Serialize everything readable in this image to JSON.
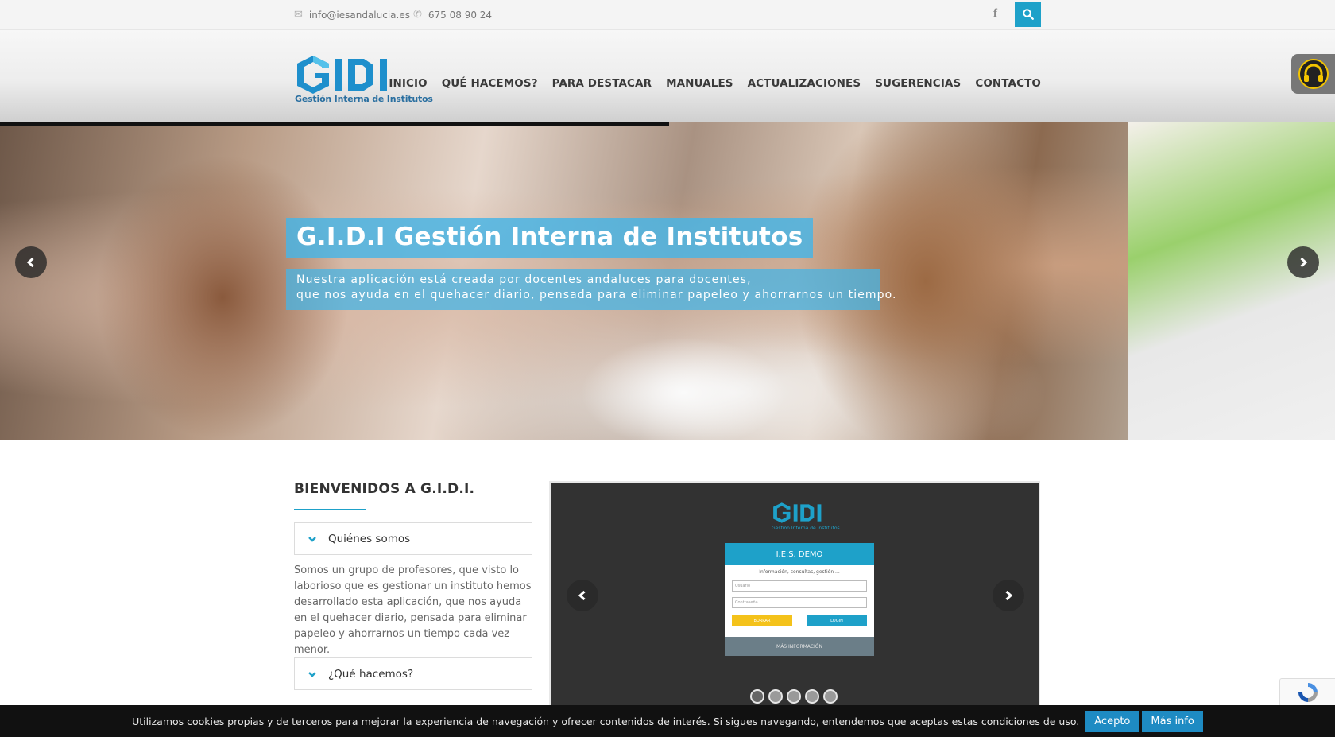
{
  "topbar": {
    "email": "info@iesandalucia.es",
    "phone": "675 08 90 24",
    "facebook_glyph": "f"
  },
  "logo": {
    "letters": "GIDI",
    "tagline": "Gestión Interna de Institutos"
  },
  "nav": [
    "INICIO",
    "QUÉ HACEMOS?",
    "PARA DESTACAR",
    "MANUALES",
    "ACTUALIZACIONES",
    "SUGERENCIAS",
    "CONTACTO"
  ],
  "hero": {
    "title": "G.I.D.I Gestión Interna de Institutos",
    "subtitle_line1": "Nuestra aplicación está creada por docentes andaluces para docentes,",
    "subtitle_line2": "que nos ayuda en el quehacer diario, pensada para eliminar papeleo y ahorrarnos un tiempo."
  },
  "welcome": {
    "heading": "BIENVENIDOS A G.I.D.I.",
    "accordion1": "Quiénes somos",
    "accordion1_text": "Somos un grupo de profesores, que visto lo laborioso que es gestionar un instituto hemos desarrollado esta aplicación, que nos ayuda en el quehacer diario, pensada para eliminar papeleo y ahorrarnos un tiempo cada vez menor.",
    "accordion2": "¿Qué hacemos?"
  },
  "screenshot_slider": {
    "mini_tagline": "Gestión Interna de Institutos",
    "login_header": "I.E.S. DEMO",
    "login_info": "Información, consultas, gestión ...",
    "user_placeholder": "Usuario",
    "pass_placeholder": "Contraseña",
    "btn_left": "BORRAR",
    "btn_right": "LOGIN",
    "footer": "MÁS INFORMACIÓN",
    "dots_count": 5
  },
  "cookie": {
    "message": "Utilizamos cookies propias y de terceros para mejorar la experiencia de navegación y ofrecer contenidos de interés. Si sigues navegando, entendemos que aceptas estas condiciones de uso.",
    "accept": "Acepto",
    "more": "Más info"
  },
  "colors": {
    "accent": "#1ea1c9",
    "hero_overlay": "#46b4e6",
    "cookie_bg": "#111111",
    "cookie_button": "#1e8bc3"
  },
  "icons": [
    "envelope-icon",
    "phone-icon",
    "facebook-icon",
    "search-icon",
    "headphones-icon",
    "chevron-left-icon",
    "chevron-right-icon",
    "chevron-down-icon",
    "recaptcha-icon"
  ]
}
